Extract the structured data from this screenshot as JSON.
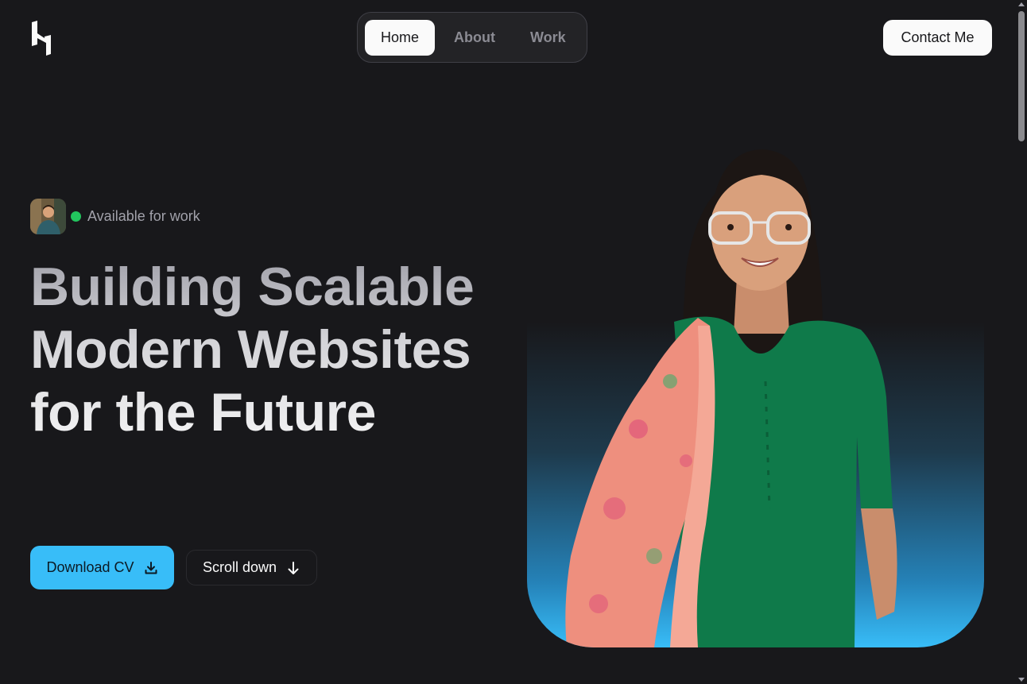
{
  "header": {
    "logo_icon": "brand-logo-icon",
    "nav": [
      {
        "label": "Home",
        "active": true
      },
      {
        "label": "About",
        "active": false
      },
      {
        "label": "Work",
        "active": false
      }
    ],
    "contact_label": "Contact Me"
  },
  "hero": {
    "status_text": "Available for work",
    "status_color": "#22c55e",
    "headline": "Building Scalable Modern Websites for the Future",
    "primary_button": {
      "label": "Download CV",
      "icon": "download-icon"
    },
    "secondary_button": {
      "label": "Scroll down",
      "icon": "arrow-down-icon"
    }
  },
  "colors": {
    "background": "#18181b",
    "accent": "#38bdf8"
  }
}
